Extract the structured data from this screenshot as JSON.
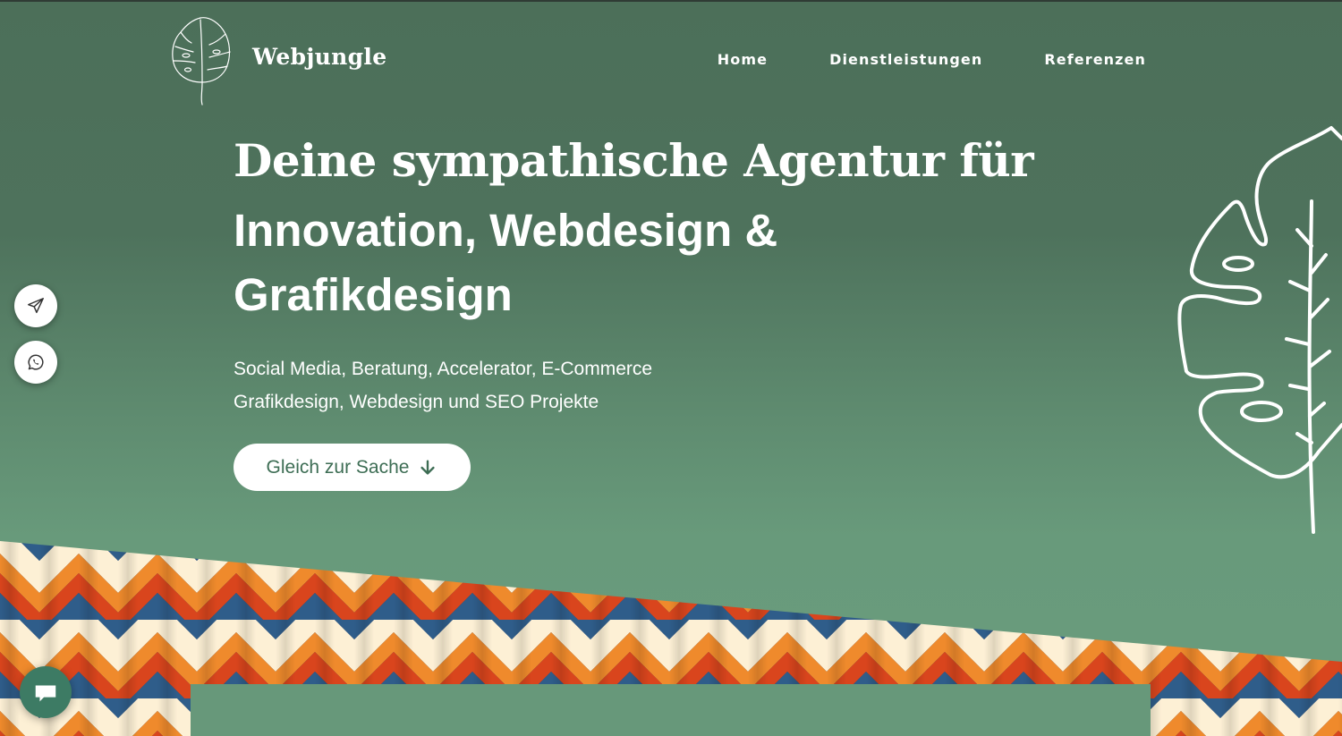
{
  "brand": {
    "name": "Webjungle"
  },
  "nav": {
    "items": [
      {
        "label": "Home"
      },
      {
        "label": "Dienstleistungen"
      },
      {
        "label": "Referenzen"
      }
    ]
  },
  "hero": {
    "headline_light": "Deine sympathische Agentur für",
    "headline_bold": "Innovation, Webdesign & Grafikdesign",
    "sub_line_1": "Social Media, Beratung, Accelerator, E-Commerce",
    "sub_line_2": "Grafikdesign, Webdesign und SEO Projekte",
    "cta_label": "Gleich zur Sache"
  },
  "floating": {
    "icons": [
      "paper-plane-icon",
      "whatsapp-icon",
      "chat-icon"
    ]
  },
  "colors": {
    "background_top": "#4d715b",
    "background_bottom": "#6a9b7d",
    "cta_text": "#3d6d54",
    "pattern_orange": "#ef8a2c",
    "pattern_red": "#d9451d",
    "pattern_navy": "#1e2f5c",
    "pattern_blue": "#2f5d8a",
    "pattern_cream": "#fdf0d5"
  }
}
